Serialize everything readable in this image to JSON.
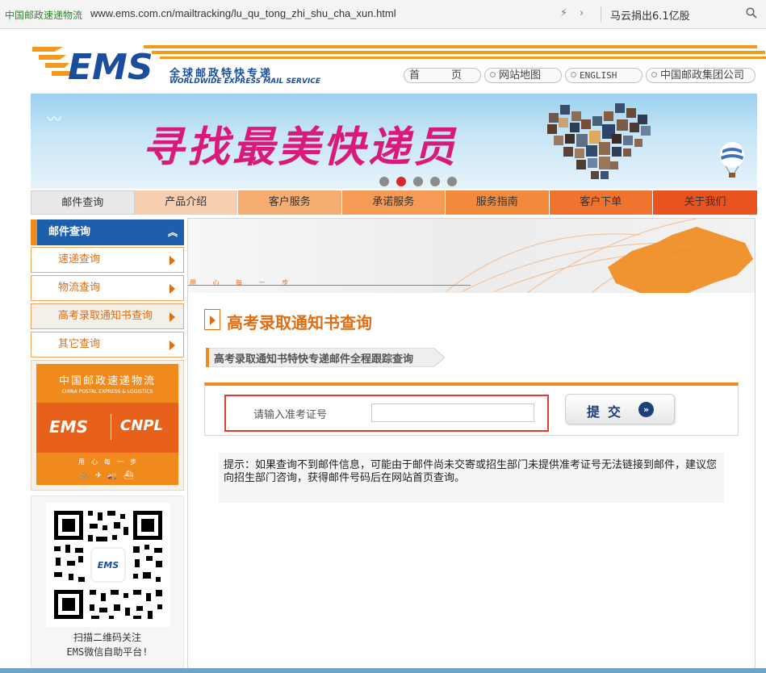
{
  "browser": {
    "site_tag": "中国邮政速递物流",
    "url": "www.ems.com.cn/mailtracking/lu_qu_tong_zhi_shu_cha_xun.html",
    "news": "马云捐出6.1亿股"
  },
  "header": {
    "logo_text": "EMS",
    "logo_cn": "全球邮政特快专递",
    "logo_en": "WORLDWIDE EXPRESS MAIL SERVICE",
    "top_links": [
      "首　　　页",
      "网站地图",
      "ENGLISH",
      "中国邮政集团公司"
    ]
  },
  "banner": {
    "title": "寻找最美快递员",
    "dot_count": 5,
    "active_dot": 1
  },
  "nav": {
    "items": [
      {
        "label": "邮件查询",
        "bg": "#e9e9e9"
      },
      {
        "label": "产品介绍",
        "bg": "#f7cfb0"
      },
      {
        "label": "客户服务",
        "bg": "#f5ad72"
      },
      {
        "label": "承诺服务",
        "bg": "#f59b55"
      },
      {
        "label": "服务指南",
        "bg": "#f28a3e"
      },
      {
        "label": "客户下单",
        "bg": "#ee7430"
      },
      {
        "label": "关于我们",
        "bg": "#e8531f"
      }
    ]
  },
  "sidebar": {
    "header": "邮件查询",
    "items": [
      {
        "label": "速递查询",
        "active": false
      },
      {
        "label": "物流查询",
        "active": false
      },
      {
        "label": "高考录取通知书查询",
        "active": true
      },
      {
        "label": "其它查询",
        "active": false
      }
    ],
    "promo": {
      "title": "中国邮政速递物流",
      "title_en": "CHINA POSTAL EXPRESS & LOGISTICS",
      "ems": "EMS",
      "cnpl": "CNPL",
      "slogan": "用　心　每　一　步"
    },
    "qr_caption_line1": "扫描二维码关注",
    "qr_caption_line2": "EMS微信自助平台!"
  },
  "main": {
    "map_slogan": "用 心 每 一 步",
    "title": "高考录取通知书查询",
    "subtitle": "高考录取通知书特快专递邮件全程跟踪查询",
    "form": {
      "label": "请输入准考证号",
      "value": "",
      "submit_label": "提交",
      "submit_icon": "»"
    },
    "tip": "提示：如果查询不到邮件信息，可能由于邮件尚未交寄或招生部门未提供准考证号无法链接到邮件，建议您向招生部门咨询，获得邮件号码后在网站首页查询。"
  },
  "colors": {
    "brand_orange": "#f08a1c",
    "brand_blue": "#1d5fab",
    "title_orange": "#e06d12",
    "alert_red": "#e53935"
  }
}
